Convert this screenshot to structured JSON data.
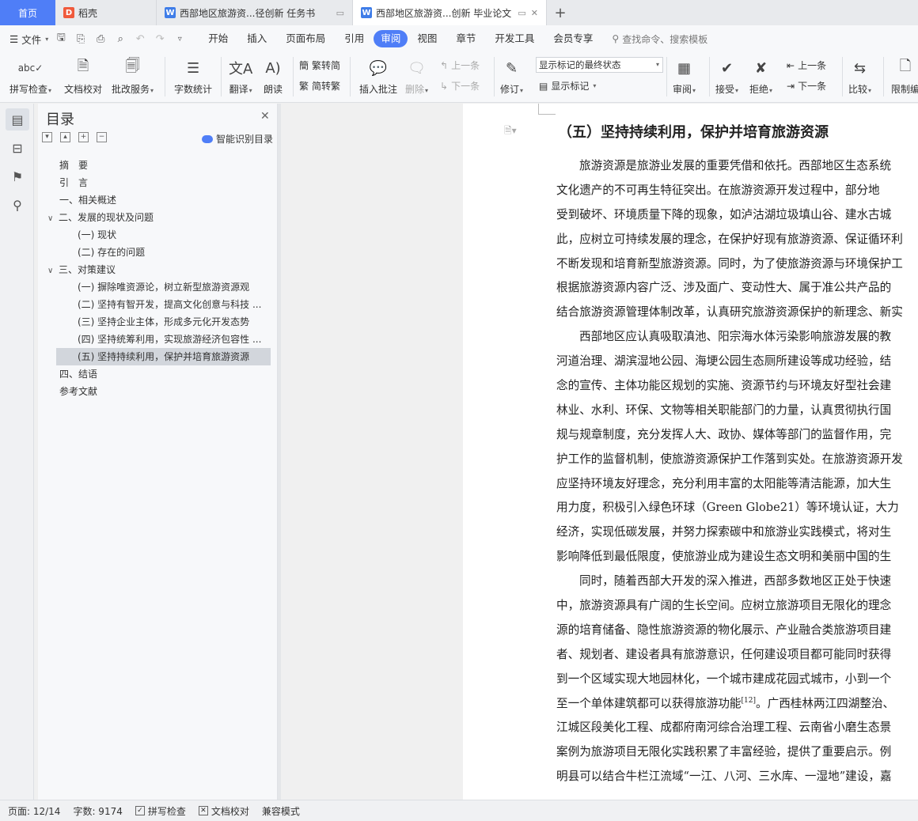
{
  "tabs": {
    "home": "首页",
    "daoke": "稻壳",
    "doc1": "西部地区旅游资...径创新 任务书",
    "doc2": "西部地区旅游资...创新 毕业论文",
    "add": "+"
  },
  "menu": {
    "file": "文件",
    "items": [
      "开始",
      "插入",
      "页面布局",
      "引用",
      "审阅",
      "视图",
      "章节",
      "开发工具",
      "会员专享"
    ],
    "active": "审阅",
    "search_placeholder": "查找命令、搜索模板"
  },
  "ribbon": {
    "spell": "拼写检查",
    "doc_check": "文档校对",
    "revise_service": "批改服务",
    "word_count": "字数统计",
    "translate": "翻译",
    "read_aloud": "朗读",
    "trad_simp": "繁转简",
    "simp_trad": "简转繁",
    "insert_comment": "插入批注",
    "delete": "删除",
    "prev": "上一条",
    "next": "下一条",
    "track": "修订",
    "display_select": "显示标记的最终状态",
    "show_markup": "显示标记",
    "review": "审阅",
    "accept": "接受",
    "reject": "拒绝",
    "prev2": "上一条",
    "next2": "下一条",
    "compare": "比较",
    "restrict": "限制编"
  },
  "toc": {
    "title": "目录",
    "smart": "智能识别目录",
    "items": [
      {
        "label": "摘　要",
        "level": 1,
        "toggle": ""
      },
      {
        "label": "引　言",
        "level": 1,
        "toggle": ""
      },
      {
        "label": "一、相关概述",
        "level": 1,
        "toggle": ""
      },
      {
        "label": "二、发展的现状及问题",
        "level": 1,
        "toggle": "∨"
      },
      {
        "label": "(一) 现状",
        "level": 2,
        "toggle": ""
      },
      {
        "label": "(二) 存在的问题",
        "level": 2,
        "toggle": ""
      },
      {
        "label": "三、对策建议",
        "level": 1,
        "toggle": "∨"
      },
      {
        "label": "(一) 摒除唯资源论，树立新型旅游资源观",
        "level": 2,
        "toggle": ""
      },
      {
        "label": "(二) 坚持有智开发，提高文化创意与科技 ...",
        "level": 2,
        "toggle": ""
      },
      {
        "label": "(三) 坚持企业主体，形成多元化开发态势",
        "level": 2,
        "toggle": ""
      },
      {
        "label": "(四) 坚持统筹利用，实现旅游经济包容性 ...",
        "level": 2,
        "toggle": ""
      },
      {
        "label": "(五) 坚持持续利用，保护并培育旅游资源",
        "level": 2,
        "toggle": "",
        "selected": true
      },
      {
        "label": "四、结语",
        "level": 1,
        "toggle": ""
      },
      {
        "label": "参考文献",
        "level": 1,
        "toggle": ""
      }
    ]
  },
  "document": {
    "heading": "（五）坚持持续利用，保护并培育旅游资源",
    "lines": [
      {
        "t": "旅游资源是旅游业发展的重要凭借和依托。西部地区生态系统",
        "ind": true
      },
      {
        "t": "文化遗产的不可再生特征突出。在旅游资源开发过程中，部分地",
        "ind": false
      },
      {
        "t": "受到破坏、环境质量下降的现象，如泸沽湖垃圾填山谷、建水古城",
        "ind": false
      },
      {
        "t": "此，应树立可持续发展的理念，在保护好现有旅游资源、保证循环利",
        "ind": false
      },
      {
        "t": "不断发现和培育新型旅游资源。同时，为了使旅游资源与环境保护工",
        "ind": false
      },
      {
        "t": "根据旅游资源内容广泛、涉及面广、变动性大、属于准公共产品的",
        "ind": false
      },
      {
        "t": "结合旅游资源管理体制改革，认真研究旅游资源保护的新理念、新实",
        "ind": false
      },
      {
        "t": "西部地区应认真吸取滇池、阳宗海水体污染影响旅游发展的教",
        "ind": true
      },
      {
        "t": "河道治理、湖滨湿地公园、海埂公园生态厕所建设等成功经验，结",
        "ind": false
      },
      {
        "t": "念的宣传、主体功能区规划的实施、资源节约与环境友好型社会建",
        "ind": false
      },
      {
        "t": "林业、水利、环保、文物等相关职能部门的力量，认真贯彻执行国",
        "ind": false
      },
      {
        "t": "规与规章制度，充分发挥人大、政协、媒体等部门的监督作用，完",
        "ind": false
      },
      {
        "t": "护工作的监督机制，使旅游资源保护工作落到实处。在旅游资源开发",
        "ind": false
      },
      {
        "t": "应坚持环境友好理念，充分利用丰富的太阳能等清洁能源，加大生",
        "ind": false
      },
      {
        "t": "用力度，积极引入绿色环球（Green Globe21）等环境认证，大力",
        "ind": false
      },
      {
        "t": "经济，实现低碳发展，并努力探索碳中和旅游业实践模式，将对生",
        "ind": false
      },
      {
        "t": "影响降低到最低限度，使旅游业成为建设生态文明和美丽中国的生",
        "ind": false
      },
      {
        "t": "同时，随着西部大开发的深入推进，西部多数地区正处于快速",
        "ind": true
      },
      {
        "t": "中，旅游资源具有广阔的生长空间。应树立旅游项目无限化的理念",
        "ind": false
      },
      {
        "t": "源的培育储备、隐性旅游资源的物化展示、产业融合类旅游项目建",
        "ind": false
      },
      {
        "t": "者、规划者、建设者具有旅游意识，任何建设项目都可能同时获得",
        "ind": false
      },
      {
        "t": "到一个区域实现大地园林化，一个城市建成花园式城市，小到一个",
        "ind": false
      },
      {
        "t": "至一个单体建筑都可以获得旅游功能",
        "ind": false,
        "sup": "[12]",
        "after": "。广西桂林两江四湖整治、"
      },
      {
        "t": "江城区段美化工程、成都府南河综合治理工程、云南省小磨生态景",
        "ind": false
      },
      {
        "t": "案例为旅游项目无限化实践积累了丰富经验，提供了重要启示。例",
        "ind": false
      },
      {
        "t": "明县可以结合牛栏江流域“一江、八河、三水库、一湿地”建设，嘉",
        "ind": false
      }
    ]
  },
  "status": {
    "page": "页面: 12/14",
    "words": "字数: 9174",
    "spell": "拼写检查",
    "doc_check": "文档校对",
    "compat": "兼容模式"
  }
}
